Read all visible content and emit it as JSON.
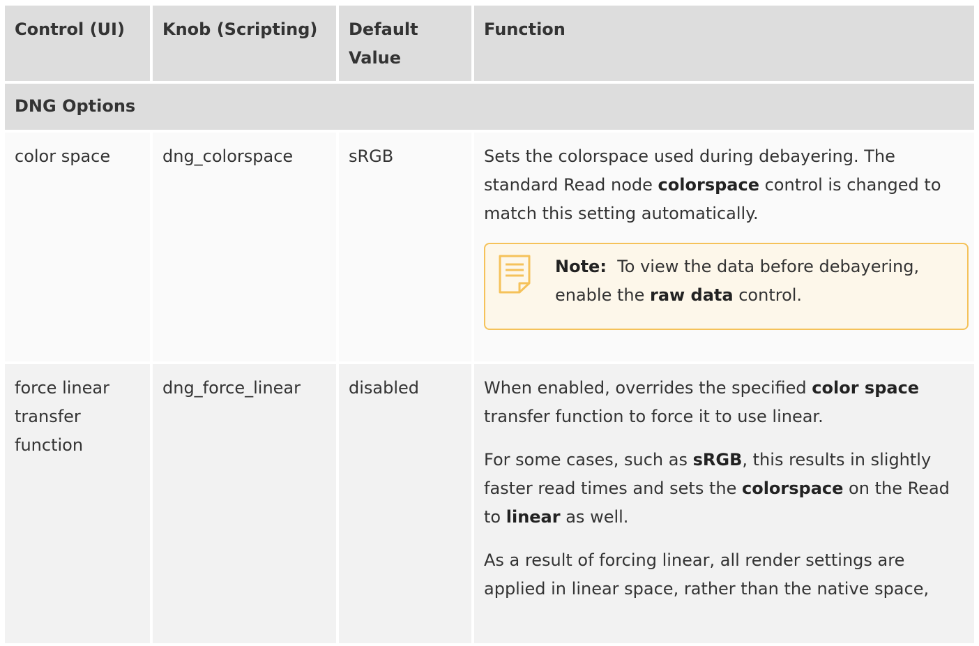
{
  "table": {
    "headers": {
      "control": "Control (UI)",
      "knob": "Knob (Scripting)",
      "default": "Default Value",
      "function": "Function"
    },
    "section_title": "DNG Options",
    "rows": [
      {
        "control": "color space",
        "knob": "dng_colorspace",
        "default": "sRGB",
        "function_p1_a": "Sets the colorspace used during debayering. The standard Read node ",
        "function_p1_b": "colorspace",
        "function_p1_c": " control is changed to match this setting automatically.",
        "note_label": "Note:",
        "note_text_a": "To view the data before debayering, enable the ",
        "note_text_b": "raw data",
        "note_text_c": " control."
      },
      {
        "control": "force linear transfer function",
        "knob": "dng_force_linear",
        "default": "disabled",
        "p1_a": "When enabled, overrides the specified ",
        "p1_b": "color space",
        "p1_c": " transfer function to force it to use linear.",
        "p2_a": "For some cases, such as ",
        "p2_b": "sRGB",
        "p2_c": ", this results in slightly faster read times and sets the ",
        "p2_d": "colorspace",
        "p2_e": " on the Read to ",
        "p2_f": "linear",
        "p2_g": " as well.",
        "p3": "As a result of forcing linear, all render settings are applied in linear space, rather than the native space,"
      }
    ]
  },
  "colors": {
    "header_bg": "#dddddd",
    "note_border": "#f5c25a",
    "note_bg": "#fdf7ea"
  },
  "icons": [
    "note-icon"
  ]
}
